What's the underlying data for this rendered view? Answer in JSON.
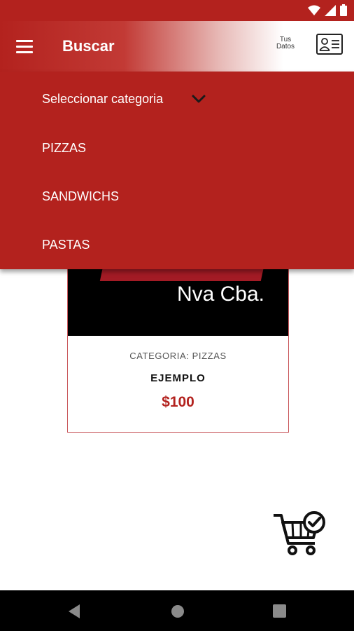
{
  "app_bar": {
    "title": "Buscar",
    "user_data_label_line1": "Tus",
    "user_data_label_line2": "Datos"
  },
  "dropdown": {
    "header": "Seleccionar categoria",
    "options": [
      "PIZZAS",
      "SANDWICHS",
      "PASTAS"
    ]
  },
  "card": {
    "image_text": "Nva Cba.",
    "category": "CATEGORIA: PIZZAS",
    "name": "EJEMPLO",
    "price": "$100"
  },
  "icons": {
    "menu": "hamburger-menu-icon",
    "profile": "id-card-icon",
    "chevron": "chevron-down-icon",
    "cart": "cart-check-icon"
  },
  "colors": {
    "brand_red": "#b3221e",
    "price_red": "#b3221e",
    "nav_bar": "#000000"
  }
}
